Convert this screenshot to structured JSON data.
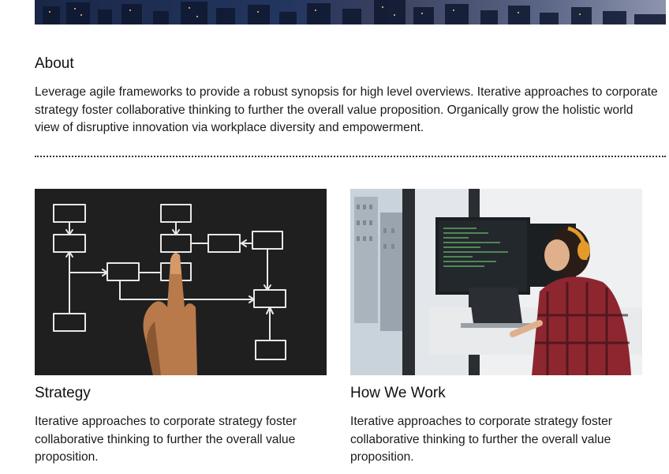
{
  "about": {
    "title": "About",
    "text": "Leverage agile frameworks to provide a robust synopsis for high level overviews. Iterative approaches to corporate strategy foster collaborative thinking to further the overall value proposition. Organically grow the holistic world view of disruptive innovation via workplace diversity and empowerment."
  },
  "cards": [
    {
      "title": "Strategy",
      "text": "Iterative approaches to corporate strategy foster collaborative thinking to further the overall value proposition.",
      "image": "flowchart-chalkboard-photo"
    },
    {
      "title": "How We Work",
      "text": "Iterative approaches to corporate strategy foster collaborative thinking to further the overall value proposition.",
      "image": "developer-at-desk-photo"
    }
  ],
  "colors": {
    "text": "#1a1a1a",
    "divider": "#333333",
    "chalkboard": "#1f1f1f"
  }
}
